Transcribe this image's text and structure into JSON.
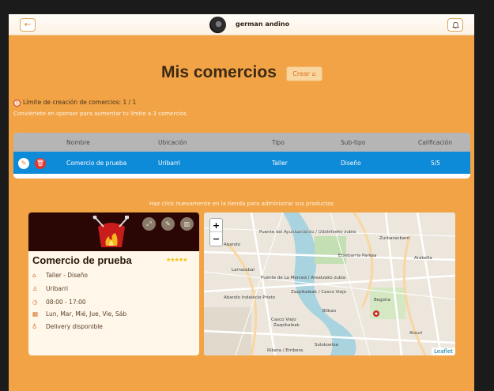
{
  "header": {
    "username": "german andino",
    "back_icon": "arrow-left-icon",
    "notification_icon": "bell-icon"
  },
  "main": {
    "title": "Mis comercios",
    "create_label": "Crear",
    "limit_text": "Límite de creación de comercios: 1 / 1",
    "sponsor_note": "Conviértete en sponsor para aumentar tu límite a 3 comercios.",
    "hint": "Haz click nuevamente en la tienda para administrar sus productos"
  },
  "table": {
    "columns": [
      "Nombre",
      "Ubicación",
      "Tipo",
      "Sub-tipo",
      "Calificación"
    ],
    "rows": [
      {
        "nombre": "Comercio de prueba",
        "ubicacion": "Uribarri",
        "tipo": "Taller",
        "subtipo": "Diseño",
        "calificacion": "5/5"
      }
    ]
  },
  "card": {
    "name": "Comercio de prueba",
    "stars": "★★★★★",
    "category": "Taller - Diseño",
    "location": "Uribarri",
    "hours": "08:00 - 17:00",
    "days": "Lun, Mar, Mié, Jue, Vie, Sáb",
    "delivery": "Delivery disponible"
  },
  "map": {
    "zoom_in": "+",
    "zoom_out": "−",
    "attribution": "Leaflet",
    "labels": [
      "Puente del Ayuntamiento / Udaletxeko zubia",
      "Zurbaranbarri",
      "Arabella",
      "Etxebarria Parkea",
      "Puente de La Merced / Areatzako zubia",
      "Zazpikaleak / Casco Viejo",
      "Begoña",
      "Abando Indalecio Prieto",
      "Casco Viejo",
      "Zazpikaleak",
      "Bilbao",
      "Atxuri",
      "Solokoetxe",
      "Ribera / Erribera",
      "Abando",
      "Larrazabal"
    ]
  },
  "colors": {
    "background": "#f1a346",
    "row_selected": "#0d8ad8",
    "table_header": "#b5b5b5",
    "stars": "#f3c20b"
  }
}
